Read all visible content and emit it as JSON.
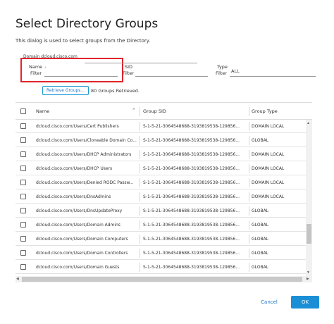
{
  "dialog": {
    "title": "Select Directory Groups",
    "description": "This dialog is used to select groups from the Directory.",
    "domain": "Domain dcloud.cisco.com"
  },
  "filters": {
    "name_label_1": "Name",
    "name_label_2": "Filter",
    "name_value": "",
    "sid_label_1": "SID",
    "sid_label_2": "Filter",
    "sid_value": "",
    "type_label_1": "Type",
    "type_label_2": "Filter",
    "type_value": "ALL"
  },
  "actions": {
    "retrieve_label": "Retrieve Groups...",
    "retrieved_text": "80 Groups Retrieved.",
    "cancel_label": "Cancel",
    "ok_label": "OK"
  },
  "table": {
    "columns": [
      "Name",
      "Group SID",
      "Group Type"
    ],
    "rows": [
      [
        "dcloud.cisco.com/Users/Cert Publishers",
        "S-1-5-21-3064548688-3193819538-129856...",
        "DOMAIN LOCAL"
      ],
      [
        "dcloud.cisco.com/Users/Cloneable Domain Co...",
        "S-1-5-21-3064548688-3193819538-129856...",
        "GLOBAL"
      ],
      [
        "dcloud.cisco.com/Users/DHCP Administrators",
        "S-1-5-21-3064548688-3193819538-129856...",
        "DOMAIN LOCAL"
      ],
      [
        "dcloud.cisco.com/Users/DHCP Users",
        "S-1-5-21-3064548688-3193819538-129856...",
        "DOMAIN LOCAL"
      ],
      [
        "dcloud.cisco.com/Users/Denied RODC Passw...",
        "S-1-5-21-3064548688-3193819538-129856...",
        "DOMAIN LOCAL"
      ],
      [
        "dcloud.cisco.com/Users/DnsAdmins",
        "S-1-5-21-3064548688-3193819538-129856...",
        "DOMAIN LOCAL"
      ],
      [
        "dcloud.cisco.com/Users/DnsUpdateProxy",
        "S-1-5-21-3064548688-3193819538-129856...",
        "GLOBAL"
      ],
      [
        "dcloud.cisco.com/Users/Domain Admins",
        "S-1-5-21-3064548688-3193819538-129856...",
        "GLOBAL"
      ],
      [
        "dcloud.cisco.com/Users/Domain Computers",
        "S-1-5-21-3064548688-3193819538-129856...",
        "GLOBAL"
      ],
      [
        "dcloud.cisco.com/Users/Domain Controllers",
        "S-1-5-21-3064548688-3193819538-129856...",
        "GLOBAL"
      ],
      [
        "dcloud.cisco.com/Users/Domain Guests",
        "S-1-5-21-3064548688-3193819538-129856...",
        "GLOBAL"
      ]
    ]
  },
  "icons": {
    "sort": "sort-ascending-icon",
    "scroll_up": "arrow-up-icon",
    "scroll_down": "arrow-down-icon",
    "scroll_left": "arrow-left-icon",
    "scroll_right": "arrow-right-icon"
  },
  "colors": {
    "accent": "#1a8fd6",
    "highlight_box": "#e0242c"
  }
}
